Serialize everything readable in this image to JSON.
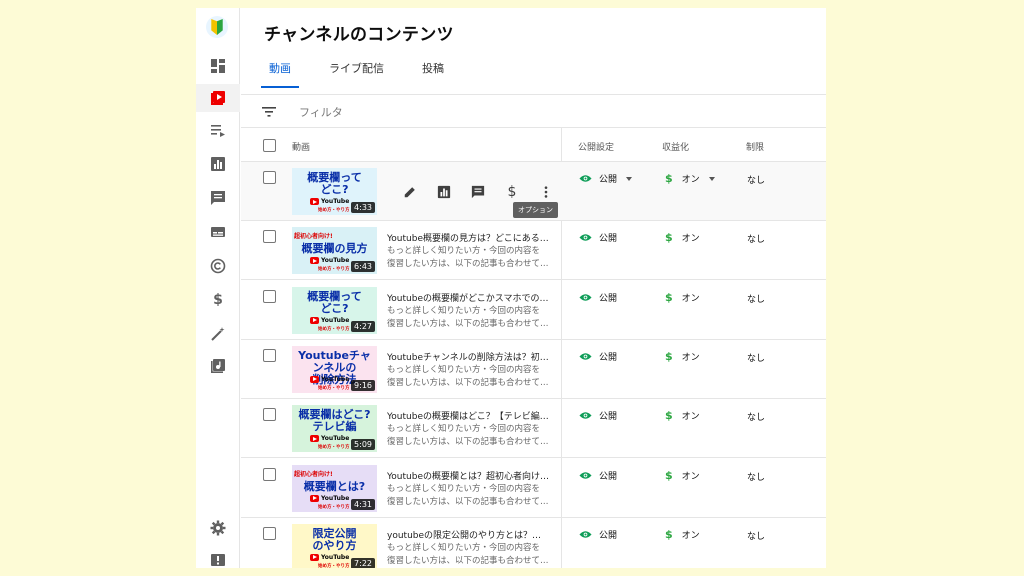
{
  "page": {
    "title": "チャンネルのコンテンツ"
  },
  "tabs": [
    {
      "label": "動画",
      "active": true
    },
    {
      "label": "ライブ配信",
      "active": false
    },
    {
      "label": "投稿",
      "active": false
    }
  ],
  "filter": {
    "placeholder": "フィルタ"
  },
  "columns": {
    "video": "動画",
    "visibility": "公開設定",
    "monetization": "収益化",
    "restrictions": "制限"
  },
  "tooltip": "オプション",
  "colors": {
    "accent": "#065fd4",
    "money": "#2ba640",
    "youtube_red": "#ff0000"
  },
  "rail_icons": [
    "dashboard-icon",
    "content-icon",
    "playlists-icon",
    "analytics-icon",
    "comments-icon",
    "subtitles-icon",
    "copyright-icon",
    "earn-icon",
    "customization-icon",
    "audio-library-icon",
    "settings-icon",
    "feedback-icon"
  ],
  "rows": [
    {
      "thumb": {
        "line1": "概要欄って",
        "line2": "どこ?",
        "bg": "#dff3fb",
        "color": "#0a2fa8",
        "tag": ""
      },
      "duration": "4:33",
      "title": "",
      "desc1": "",
      "desc2": "",
      "visibility": "公開",
      "monetization": "オン",
      "restrictions": "なし",
      "hover": true
    },
    {
      "thumb": {
        "line1": "概要欄の見方",
        "line2": "",
        "bg": "#d9f1f6",
        "color": "#0a2fa8",
        "tag": "超初心者向け!"
      },
      "duration": "6:43",
      "title": "Youtube概要欄の見方は？どこにある…",
      "desc1": "もっと詳しく知りたい方・今回の内容を",
      "desc2": "復習したい方は、以下の記事も合わせて…",
      "visibility": "公開",
      "monetization": "オン",
      "restrictions": "なし",
      "hover": false
    },
    {
      "thumb": {
        "line1": "概要欄って",
        "line2": "どこ?",
        "bg": "#d7f5ea",
        "color": "#0a2fa8",
        "tag": ""
      },
      "duration": "4:27",
      "title": "Youtubeの概要欄がどこかスマホでの…",
      "desc1": "もっと詳しく知りたい方・今回の内容を",
      "desc2": "復習したい方は、以下の記事も合わせて…",
      "visibility": "公開",
      "monetization": "オン",
      "restrictions": "なし",
      "hover": false
    },
    {
      "thumb": {
        "line1": "Youtubeチャンネルの",
        "line2": "削除方法",
        "bg": "#fbe3ef",
        "color": "#0a2fa8",
        "tag": ""
      },
      "duration": "9:16",
      "title": "Youtubeチャンネルの削除方法は？初…",
      "desc1": "もっと詳しく知りたい方・今回の内容を",
      "desc2": "復習したい方は、以下の記事も合わせて…",
      "visibility": "公開",
      "monetization": "オン",
      "restrictions": "なし",
      "hover": false
    },
    {
      "thumb": {
        "line1": "概要欄はどこ?",
        "line2": "テレビ編",
        "bg": "#d6f3dc",
        "color": "#0a2fa8",
        "tag": ""
      },
      "duration": "5:09",
      "title": "Youtubeの概要欄はどこ？【テレビ編…",
      "desc1": "もっと詳しく知りたい方・今回の内容を",
      "desc2": "復習したい方は、以下の記事も合わせて…",
      "visibility": "公開",
      "monetization": "オン",
      "restrictions": "なし",
      "hover": false
    },
    {
      "thumb": {
        "line1": "概要欄とは?",
        "line2": "",
        "bg": "#e6ddf6",
        "color": "#0a2fa8",
        "tag": "超初心者向け!"
      },
      "duration": "4:31",
      "title": "Youtubeの概要欄とは？超初心者向け…",
      "desc1": "もっと詳しく知りたい方・今回の内容を",
      "desc2": "復習したい方は、以下の記事も合わせて…",
      "visibility": "公開",
      "monetization": "オン",
      "restrictions": "なし",
      "hover": false
    },
    {
      "thumb": {
        "line1": "限定公開",
        "line2": "のやり方",
        "bg": "#fff8c8",
        "color": "#0a2fa8",
        "tag": ""
      },
      "duration": "7:22",
      "title": "youtubeの限定公開のやり方とは？方…",
      "desc1": "もっと詳しく知りたい方・今回の内容を",
      "desc2": "復習したい方は、以下の記事も合わせて…",
      "visibility": "公開",
      "monetization": "オン",
      "restrictions": "なし",
      "hover": false
    }
  ],
  "thumb_brand": {
    "yt": "YouTube",
    "sub": "始め方・やり方"
  }
}
